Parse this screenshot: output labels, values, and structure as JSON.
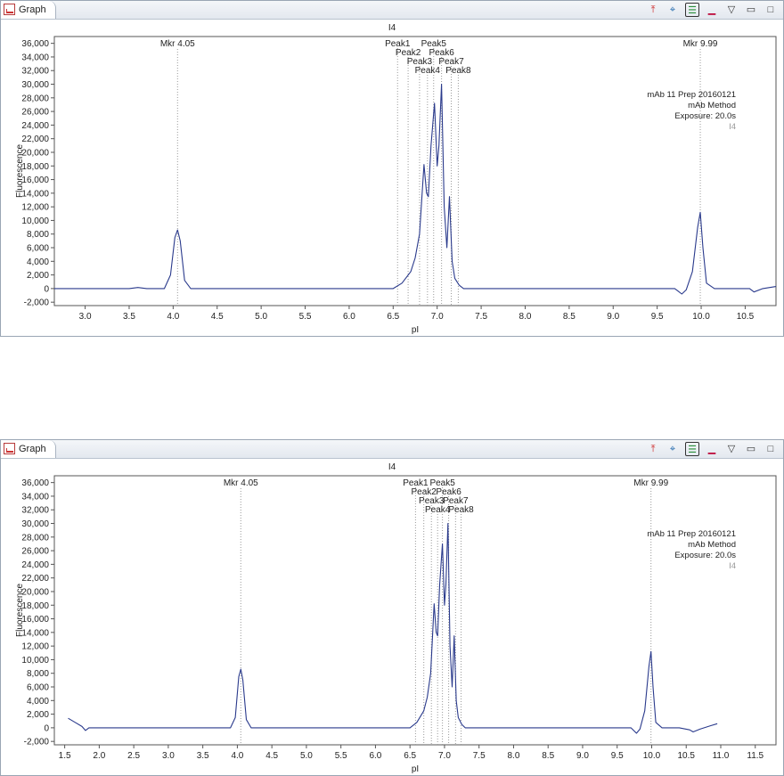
{
  "panels": [
    {
      "tab_label": "Graph",
      "toolbar": [
        "pin-icon",
        "marker-icon",
        "legend-icon",
        "minimize-icon",
        "menu-icon",
        "restore-icon",
        "maximize-icon"
      ],
      "chart_data": {
        "type": "line",
        "title": "I4",
        "xlabel": "pI",
        "ylabel": "Fluorescence",
        "xlim": [
          2.65,
          10.85
        ],
        "ylim": [
          -2500,
          37000
        ],
        "xticks": [
          "3.0",
          "3.5",
          "4.0",
          "4.5",
          "5.0",
          "5.5",
          "6.0",
          "6.5",
          "7.0",
          "7.5",
          "8.0",
          "8.5",
          "9.0",
          "9.5",
          "10.0",
          "10.5"
        ],
        "yticks": [
          "-2,000",
          "0",
          "2,000",
          "4,000",
          "6,000",
          "8,000",
          "10,000",
          "12,000",
          "14,000",
          "16,000",
          "18,000",
          "20,000",
          "22,000",
          "24,000",
          "26,000",
          "28,000",
          "30,000",
          "32,000",
          "34,000",
          "36,000"
        ],
        "markers": [
          {
            "label": "Mkr 4.05",
            "x": 4.05
          },
          {
            "label": "Mkr 9.99",
            "x": 9.99
          }
        ],
        "peaks": [
          {
            "label": "Peak1",
            "x": 6.55
          },
          {
            "label": "Peak2",
            "x": 6.67
          },
          {
            "label": "Peak3",
            "x": 6.8
          },
          {
            "label": "Peak4",
            "x": 6.89
          },
          {
            "label": "Peak5",
            "x": 6.96
          },
          {
            "label": "Peak6",
            "x": 7.05
          },
          {
            "label": "Peak7",
            "x": 7.16
          },
          {
            "label": "Peak8",
            "x": 7.24
          }
        ],
        "annotation": [
          "mAb 11 Prep 20160121",
          "mAb Method",
          "Exposure: 20.0s",
          "I4"
        ],
        "series": [
          {
            "x": [
              2.65,
              3.0,
              3.5,
              3.6,
              3.7,
              3.9,
              3.97,
              4.02,
              4.05,
              4.08,
              4.13,
              4.2,
              4.5,
              5.0,
              5.5,
              6.0,
              6.5,
              6.6,
              6.7,
              6.75,
              6.8,
              6.85,
              6.88,
              6.9,
              6.93,
              6.97,
              7.0,
              7.02,
              7.05,
              7.08,
              7.11,
              7.14,
              7.17,
              7.2,
              7.25,
              7.3,
              7.5,
              8.0,
              8.5,
              9.0,
              9.5,
              9.7,
              9.78,
              9.83,
              9.9,
              9.96,
              9.99,
              10.02,
              10.06,
              10.15,
              10.4,
              10.55,
              10.6,
              10.7,
              10.85
            ],
            "y": [
              0,
              0,
              0,
              150,
              0,
              0,
              2000,
              7500,
              8600,
              7000,
              1200,
              0,
              0,
              0,
              0,
              0,
              0,
              800,
              2500,
              4500,
              8000,
              18200,
              14000,
              13500,
              21000,
              27200,
              18000,
              21000,
              30000,
              12000,
              6000,
              13500,
              4000,
              1500,
              500,
              0,
              0,
              0,
              0,
              0,
              0,
              0,
              -800,
              -200,
              2500,
              9000,
              11200,
              6000,
              800,
              0,
              0,
              0,
              -500,
              0,
              300
            ]
          }
        ]
      }
    },
    {
      "tab_label": "Graph",
      "toolbar": [
        "pin-icon",
        "marker-icon",
        "legend-icon",
        "minimize-icon",
        "menu-icon",
        "restore-icon",
        "maximize-icon"
      ],
      "chart_data": {
        "type": "line",
        "title": "I4",
        "xlabel": "pI",
        "ylabel": "Fluorescence",
        "xlim": [
          1.35,
          11.8
        ],
        "ylim": [
          -2500,
          37000
        ],
        "xticks": [
          "1.5",
          "2.0",
          "2.5",
          "3.0",
          "3.5",
          "4.0",
          "4.5",
          "5.0",
          "5.5",
          "6.0",
          "6.5",
          "7.0",
          "7.5",
          "8.0",
          "8.5",
          "9.0",
          "9.5",
          "10.0",
          "10.5",
          "11.0",
          "11.5"
        ],
        "yticks": [
          "-2,000",
          "0",
          "2,000",
          "4,000",
          "6,000",
          "8,000",
          "10,000",
          "12,000",
          "14,000",
          "16,000",
          "18,000",
          "20,000",
          "22,000",
          "24,000",
          "26,000",
          "28,000",
          "30,000",
          "32,000",
          "34,000",
          "36,000"
        ],
        "markers": [
          {
            "label": "Mkr 4.05",
            "x": 4.05
          },
          {
            "label": "Mkr 9.99",
            "x": 9.99
          }
        ],
        "peaks": [
          {
            "label": "Peak1",
            "x": 6.58
          },
          {
            "label": "Peak2",
            "x": 6.7
          },
          {
            "label": "Peak3",
            "x": 6.81
          },
          {
            "label": "Peak4",
            "x": 6.9
          },
          {
            "label": "Peak5",
            "x": 6.97
          },
          {
            "label": "Peak6",
            "x": 7.06
          },
          {
            "label": "Peak7",
            "x": 7.16
          },
          {
            "label": "Peak8",
            "x": 7.24
          }
        ],
        "annotation": [
          "mAb 11 Prep 20160121",
          "mAb Method",
          "Exposure: 20.0s",
          "I4"
        ],
        "series": [
          {
            "x": [
              1.55,
              1.65,
              1.75,
              1.8,
              1.85,
              2.0,
              3.0,
              3.5,
              3.9,
              3.97,
              4.02,
              4.05,
              4.08,
              4.13,
              4.2,
              5.0,
              6.0,
              6.5,
              6.6,
              6.7,
              6.75,
              6.8,
              6.85,
              6.88,
              6.9,
              6.93,
              6.97,
              7.0,
              7.02,
              7.05,
              7.08,
              7.11,
              7.14,
              7.17,
              7.2,
              7.25,
              7.3,
              8.0,
              9.0,
              9.5,
              9.7,
              9.78,
              9.83,
              9.9,
              9.96,
              9.99,
              10.02,
              10.06,
              10.15,
              10.4,
              10.55,
              10.6,
              10.7,
              10.85,
              10.95
            ],
            "y": [
              1400,
              800,
              200,
              -400,
              0,
              0,
              0,
              0,
              0,
              1500,
              7500,
              8600,
              7000,
              1200,
              0,
              0,
              0,
              0,
              800,
              2500,
              4500,
              8000,
              18200,
              14000,
              13500,
              21000,
              27000,
              18000,
              21000,
              30000,
              12000,
              6000,
              13500,
              4000,
              1500,
              500,
              0,
              0,
              0,
              0,
              0,
              -800,
              -200,
              2500,
              9000,
              11200,
              6000,
              800,
              0,
              0,
              -300,
              -600,
              -200,
              300,
              600
            ]
          }
        ]
      }
    }
  ]
}
